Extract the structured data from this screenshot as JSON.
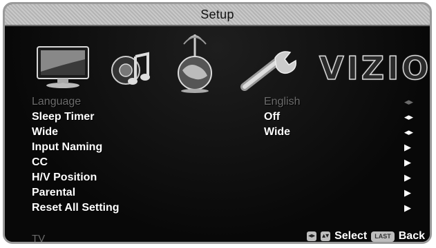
{
  "window": {
    "title": "Setup"
  },
  "brand": {
    "logo_text": "VIZIO"
  },
  "category_icons": [
    {
      "name": "tv-icon"
    },
    {
      "name": "audio-icon"
    },
    {
      "name": "network-globe-icon"
    },
    {
      "name": "wrench-icon"
    }
  ],
  "menu": {
    "items": [
      {
        "label": "Language",
        "value": "English",
        "arrow": "◂▸",
        "state": "disabled"
      },
      {
        "label": "Sleep Timer",
        "value": "Off",
        "arrow": "◂▸",
        "state": "enabled"
      },
      {
        "label": "Wide",
        "value": "Wide",
        "arrow": "◂▸",
        "state": "enabled"
      },
      {
        "label": "Input Naming",
        "value": "",
        "arrow": "▶",
        "state": "enabled"
      },
      {
        "label": "CC",
        "value": "",
        "arrow": "▶",
        "state": "enabled"
      },
      {
        "label": "H/V Position",
        "value": "",
        "arrow": "▶",
        "state": "enabled"
      },
      {
        "label": "Parental",
        "value": "",
        "arrow": "▶",
        "state": "enabled"
      },
      {
        "label": "Reset All Setting",
        "value": "",
        "arrow": "▶",
        "state": "enabled"
      }
    ]
  },
  "footer": {
    "source": "TV",
    "select_label": "Select",
    "last_key": "LAST",
    "back_label": "Back"
  },
  "colors": {
    "background": "#0b0b0b",
    "title_bar": "#c0c0c0",
    "text": "#ffffff",
    "dim_text": "#6c6c6c"
  }
}
